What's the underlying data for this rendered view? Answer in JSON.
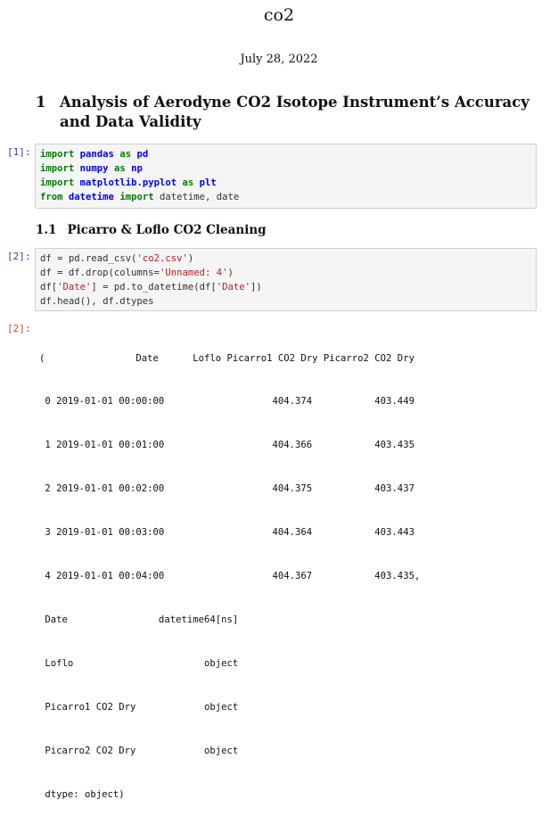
{
  "doc": {
    "title": "co2",
    "date": "July 28, 2022"
  },
  "section1": {
    "number": "1",
    "title": "Analysis of Aerodyne CO2 Isotope Instrument’s Accuracy and Data Validity"
  },
  "cell1": {
    "prompt": "[1]:",
    "lines": [
      [
        {
          "t": "import",
          "c": "kw"
        },
        {
          "t": " ",
          "c": "plain"
        },
        {
          "t": "pandas",
          "c": "mod"
        },
        {
          "t": " ",
          "c": "plain"
        },
        {
          "t": "as",
          "c": "kw"
        },
        {
          "t": " ",
          "c": "plain"
        },
        {
          "t": "pd",
          "c": "mod"
        }
      ],
      [
        {
          "t": "import",
          "c": "kw"
        },
        {
          "t": " ",
          "c": "plain"
        },
        {
          "t": "numpy",
          "c": "mod"
        },
        {
          "t": " ",
          "c": "plain"
        },
        {
          "t": "as",
          "c": "kw"
        },
        {
          "t": " ",
          "c": "plain"
        },
        {
          "t": "np",
          "c": "mod"
        }
      ],
      [
        {
          "t": "import",
          "c": "kw"
        },
        {
          "t": " ",
          "c": "plain"
        },
        {
          "t": "matplotlib.pyplot",
          "c": "mod"
        },
        {
          "t": " ",
          "c": "plain"
        },
        {
          "t": "as",
          "c": "kw"
        },
        {
          "t": " ",
          "c": "plain"
        },
        {
          "t": "plt",
          "c": "mod"
        }
      ],
      [
        {
          "t": "from",
          "c": "kw"
        },
        {
          "t": " ",
          "c": "plain"
        },
        {
          "t": "datetime",
          "c": "mod"
        },
        {
          "t": " ",
          "c": "plain"
        },
        {
          "t": "import",
          "c": "kw"
        },
        {
          "t": " datetime, date",
          "c": "plain"
        }
      ]
    ]
  },
  "section1_1": {
    "number": "1.1",
    "title": "Picarro & Loflo CO2 Cleaning"
  },
  "cell2": {
    "prompt": "[2]:",
    "lines": [
      [
        {
          "t": "df = pd.read_csv(",
          "c": "plain"
        },
        {
          "t": "'co2.csv'",
          "c": "str"
        },
        {
          "t": ")",
          "c": "plain"
        }
      ],
      [
        {
          "t": "df = df.drop(columns=",
          "c": "plain"
        },
        {
          "t": "'Unnamed: 4'",
          "c": "str"
        },
        {
          "t": ")",
          "c": "plain"
        }
      ],
      [
        {
          "t": "df[",
          "c": "plain"
        },
        {
          "t": "'Date'",
          "c": "str"
        },
        {
          "t": "] = pd.to_datetime(df[",
          "c": "plain"
        },
        {
          "t": "'Date'",
          "c": "str"
        },
        {
          "t": "])",
          "c": "plain"
        }
      ],
      [
        {
          "t": "df.head(), df.dtypes",
          "c": "plain"
        }
      ]
    ]
  },
  "output2": {
    "prompt": "[2]:",
    "lines": [
      "(                Date      Loflo Picarro1 CO2 Dry Picarro2 CO2 Dry",
      " 0 2019-01-01 00:00:00                   404.374           403.449",
      " 1 2019-01-01 00:01:00                   404.366           403.435",
      " 2 2019-01-01 00:02:00                   404.375           403.437",
      " 3 2019-01-01 00:03:00                   404.364           403.443",
      " 4 2019-01-01 00:04:00                   404.367           403.435,",
      " Date                datetime64[ns]",
      " Loflo                       object",
      " Picarro1 CO2 Dry            object",
      " Picarro2 CO2 Dry            object",
      " dtype: object)"
    ]
  }
}
